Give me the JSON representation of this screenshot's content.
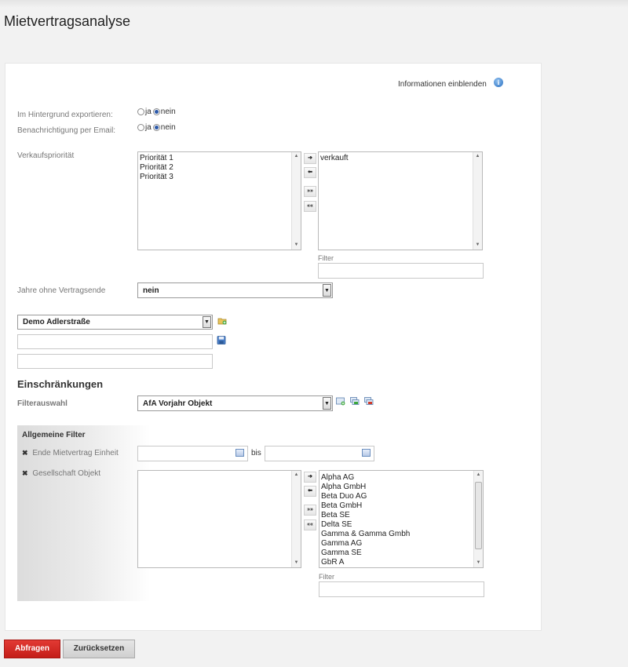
{
  "page_title": "Mietvertragsanalyse",
  "info": {
    "link_label": "Informationen einblenden",
    "icon": "info-icon"
  },
  "export_background": {
    "label": "Im Hintergrund exportieren:",
    "yes": "ja",
    "no": "nein",
    "selected": "nein"
  },
  "email_notification": {
    "label": "Benachrichtigung per Email:",
    "yes": "ja",
    "no": "nein",
    "selected": "nein"
  },
  "sales_priority": {
    "label": "Verkaufspriorität",
    "available": [
      "Priorität 1",
      "Priorität 2",
      "Priorität 3"
    ],
    "selected": [
      "verkauft"
    ],
    "filter_label": "Filter",
    "filter_value": ""
  },
  "years_without_end": {
    "label": "Jahre ohne Vertragsende",
    "value": "nein"
  },
  "preset": {
    "value": "Demo Adlerstraße",
    "name_input": "",
    "second_input": ""
  },
  "restrictions": {
    "heading": "Einschränkungen",
    "filter_label": "Filterauswahl",
    "filter_value": "AfA Vorjahr Objekt"
  },
  "general_filters": {
    "heading": "Allgemeine Filter",
    "end_contract": {
      "label": "Ende Mietvertrag Einheit",
      "from": "",
      "to_label": "bis",
      "to": ""
    },
    "company": {
      "label": "Gesellschaft Objekt",
      "available": [],
      "options": [
        "Alpha AG",
        "Alpha GmbH",
        "Beta Duo AG",
        "Beta GmbH",
        "Beta SE",
        "Delta SE",
        "Gamma & Gamma Gmbh",
        "Gamma AG",
        "Gamma SE",
        "GbR A"
      ],
      "filter_label": "Filter",
      "filter_value": ""
    }
  },
  "buttons": {
    "query": "Abfragen",
    "reset": "Zurücksetzen"
  },
  "colors": {
    "primary": "#d42a25",
    "accent": "#2b58a8"
  }
}
